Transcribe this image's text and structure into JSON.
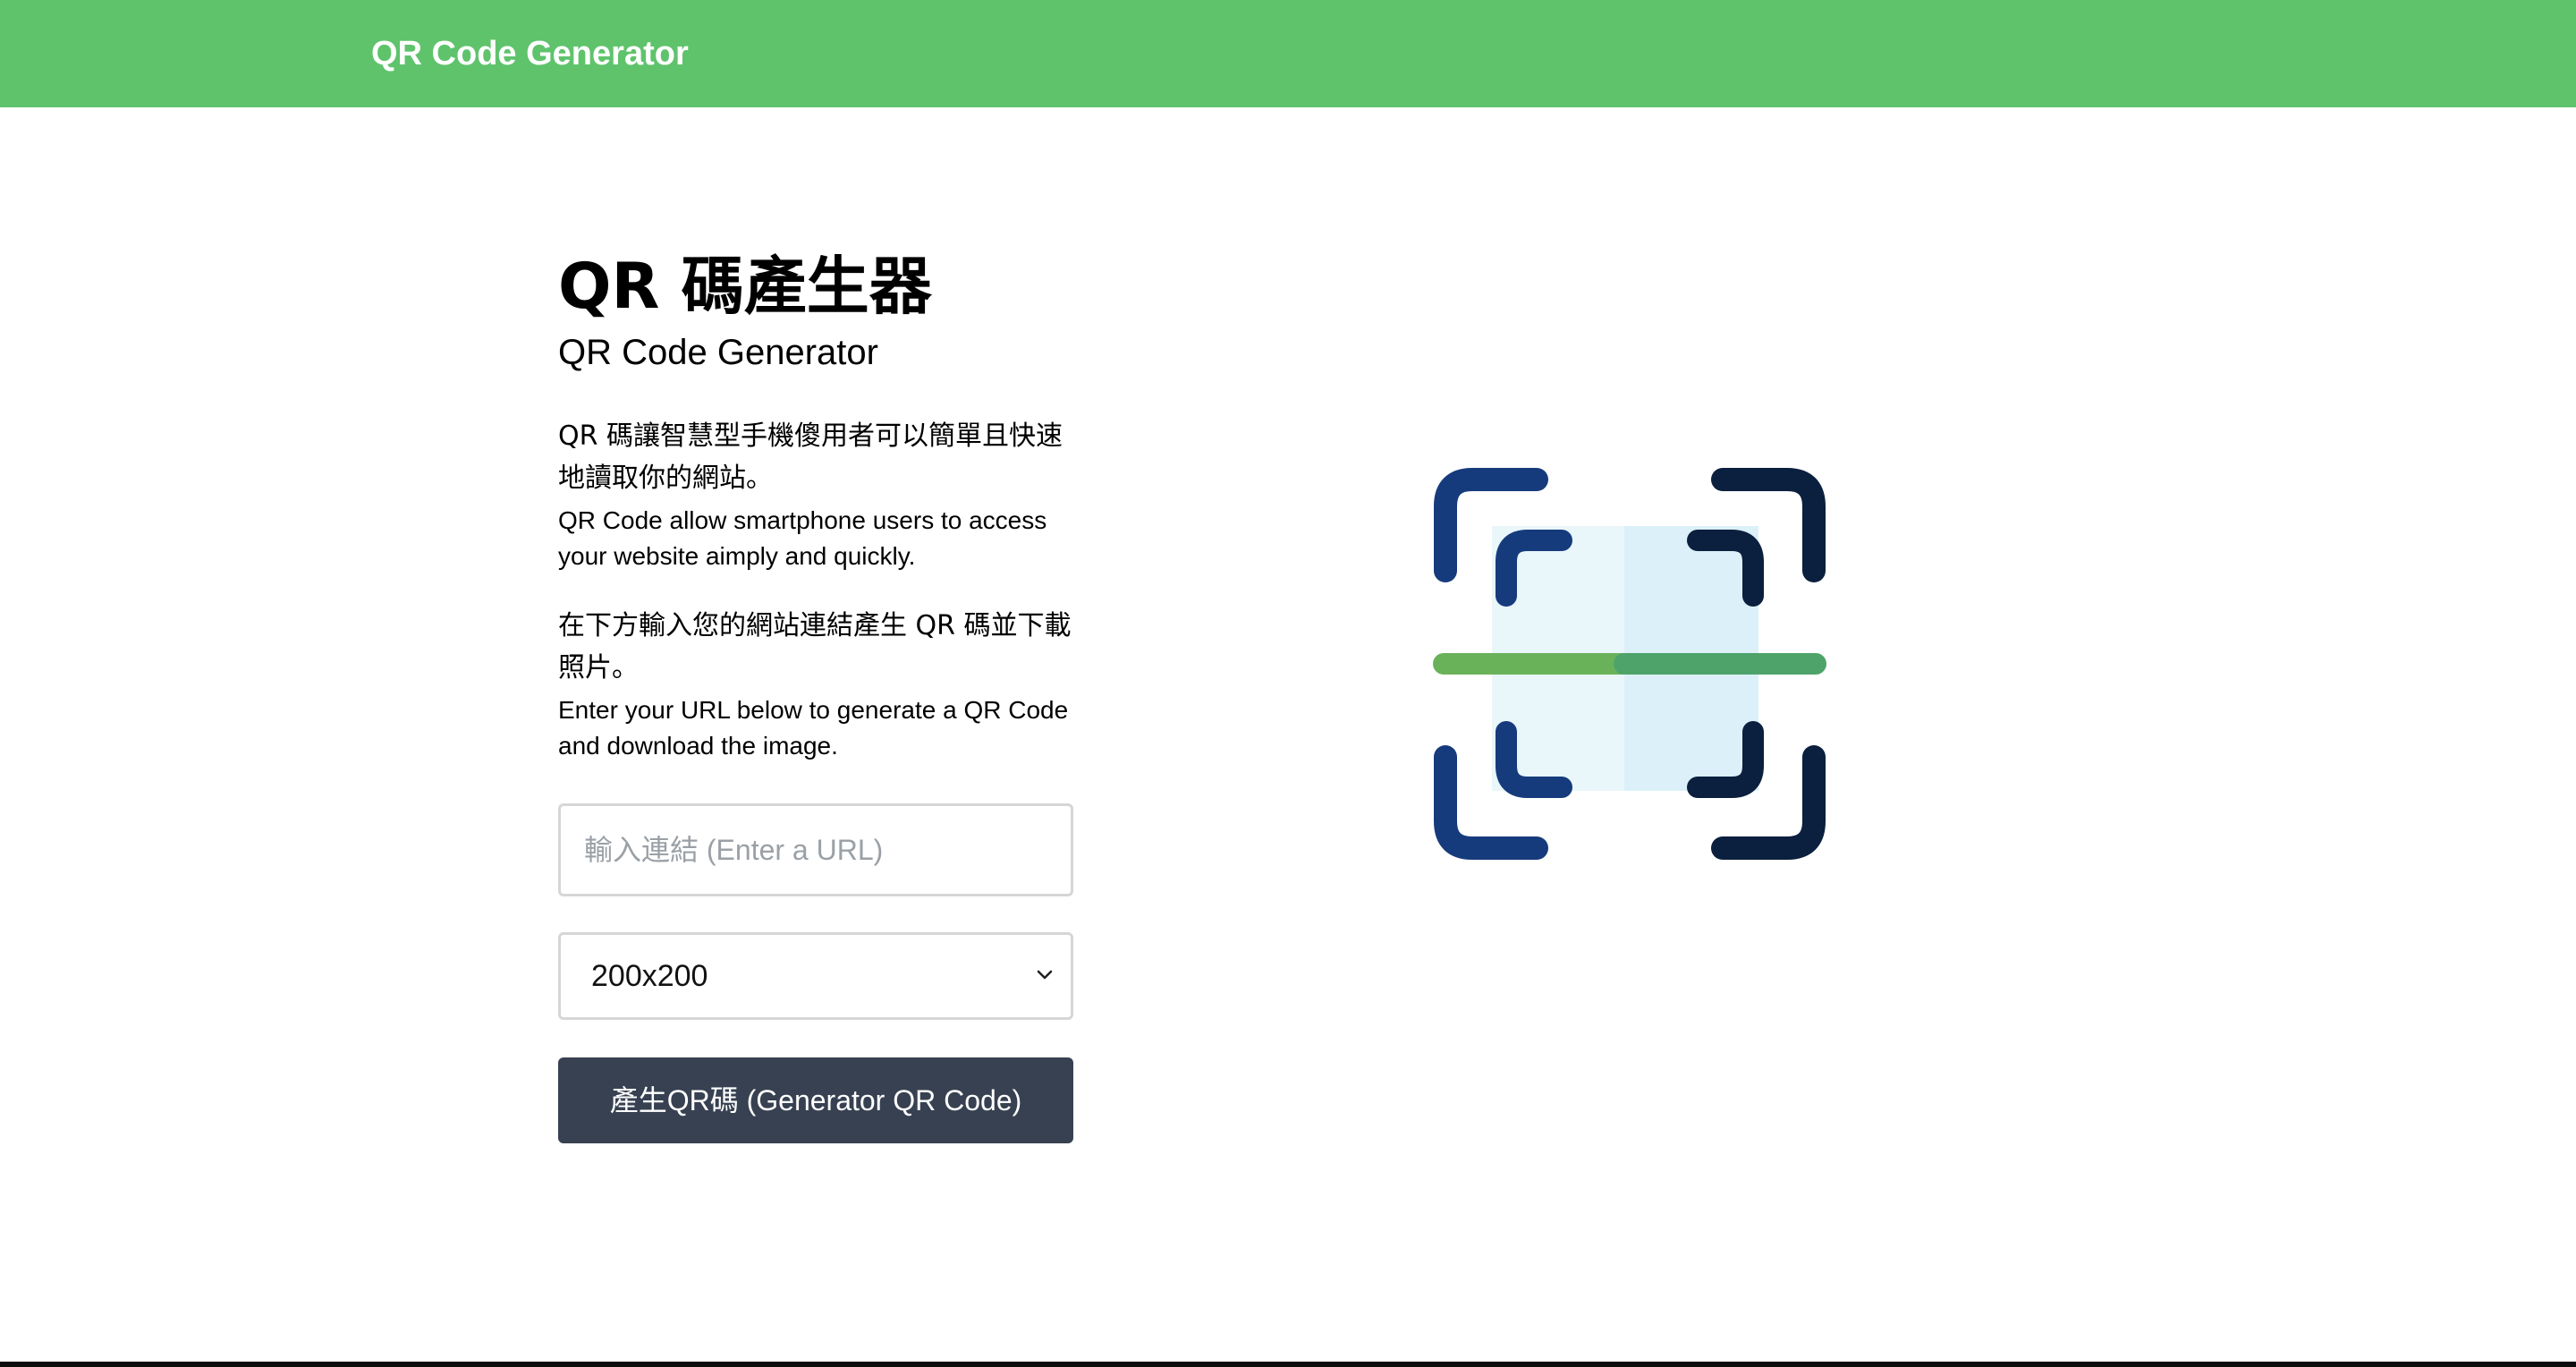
{
  "navbar": {
    "brand": "QR Code Generator",
    "bg_color": "#5fc36c"
  },
  "main": {
    "title": "QR 碼產生器",
    "subtitle": "QR Code Generator",
    "description_zh": "QR 碼讓智慧型手機傻用者可以簡單且快速地讀取你的網站。",
    "description_en": "QR Code allow smartphone users to access your website aimply and quickly.",
    "instruction_zh": "在下方輸入您的網站連結產生 QR 碼並下載照片。",
    "instruction_en": "Enter your URL below to generate a QR Code and download the image."
  },
  "form": {
    "url_input": {
      "placeholder": "輸入連結 (Enter a URL)",
      "value": ""
    },
    "size_select": {
      "selected": "200x200"
    },
    "generate_button": "產生QR碼 (Generator QR Code)",
    "button_color": "#374151"
  },
  "illustration": {
    "icon": "qr-scan-icon",
    "colors": {
      "frame_dark_blue": "#163b7c",
      "frame_navy": "#0b1f3e",
      "scan_line_green": "#6ab25a",
      "scan_area_light": "#e9f6fa"
    }
  }
}
